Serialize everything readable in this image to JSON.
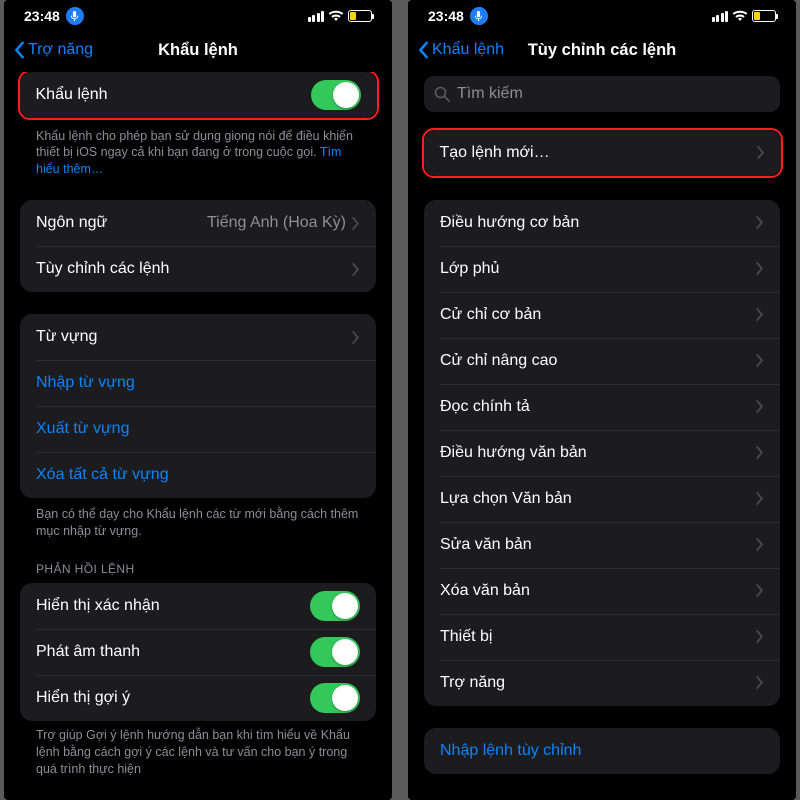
{
  "status": {
    "time": "23:48"
  },
  "left": {
    "back": "Trợ năng",
    "title": "Khẩu lệnh",
    "toggle_row": "Khẩu lệnh",
    "toggle_desc": "Khẩu lệnh cho phép bạn sử dụng giọng nói để điều khiển thiết bị iOS ngay cả khi bạn đang ở trong cuộc gọi. ",
    "toggle_link": "Tìm hiểu thêm…",
    "lang_label": "Ngôn ngữ",
    "lang_value": "Tiếng Anh (Hoa Kỳ)",
    "customize": "Tùy chỉnh các lệnh",
    "vocab": "Từ vựng",
    "import_vocab": "Nhập từ vựng",
    "export_vocab": "Xuất từ vựng",
    "delete_vocab": "Xóa tất cả từ vựng",
    "vocab_note": "Bạn có thể dạy cho Khẩu lệnh các từ mới bằng cách thêm mục nhập từ vựng.",
    "feedback_header": "PHẢN HỒI LỆNH",
    "show_confirm": "Hiển thị xác nhận",
    "play_sound": "Phát âm thanh",
    "show_hints": "Hiển thị gợi ý",
    "hints_note": "Trợ giúp Gợi ý lệnh hướng dẫn bạn khi tìm hiểu về Khẩu lệnh bằng cách gợi ý các lệnh và tư vấn cho bạn ý trong quá trình thực hiện"
  },
  "right": {
    "back": "Khẩu lệnh",
    "title": "Tùy chỉnh các lệnh",
    "search_placeholder": "Tìm kiếm",
    "create_new": "Tạo lệnh mới…",
    "cat0": "Điều hướng cơ bản",
    "cat1": "Lớp phủ",
    "cat2": "Cử chỉ cơ bản",
    "cat3": "Cử chỉ nâng cao",
    "cat4": "Đọc chính tả",
    "cat5": "Điều hướng văn bản",
    "cat6": "Lựa chọn Văn bản",
    "cat7": "Sửa văn bản",
    "cat8": "Xóa văn bản",
    "cat9": "Thiết bị",
    "cat10": "Trợ năng",
    "custom_import": "Nhập lệnh tùy chỉnh"
  }
}
